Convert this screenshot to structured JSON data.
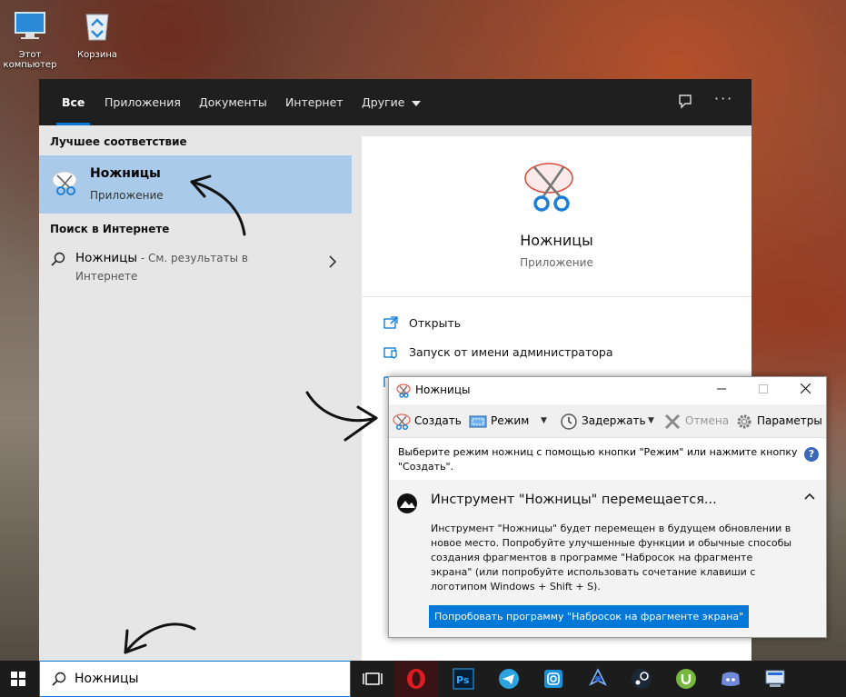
{
  "desktop": {
    "icons": [
      {
        "label": "Этот компьютер",
        "icon": "this-pc-icon"
      },
      {
        "label": "Корзина",
        "icon": "recycle-bin-icon"
      }
    ]
  },
  "start_menu": {
    "tabs": [
      {
        "label": "Все",
        "active": true
      },
      {
        "label": "Приложения"
      },
      {
        "label": "Документы"
      },
      {
        "label": "Интернет"
      },
      {
        "label": "Другие"
      }
    ],
    "feedback_icon": "feedback-icon",
    "more_icon": "more-options-icon",
    "best_match_header": "Лучшее соответствие",
    "best_match": {
      "name": "Ножницы",
      "type": "Приложение",
      "icon": "snipping-tool-icon"
    },
    "web_header": "Поиск в Интернете",
    "web_result": {
      "query": "Ножницы",
      "suffix": " - См. результаты в Интернете"
    },
    "detail": {
      "name": "Ножницы",
      "type": "Приложение",
      "actions": [
        {
          "label": "Открыть",
          "icon": "open-icon"
        },
        {
          "label": "Запуск от имени администратора",
          "icon": "run-as-admin-icon"
        },
        {
          "label": "",
          "icon": "file-location-icon"
        }
      ]
    }
  },
  "snipping_window": {
    "title": "Ножницы",
    "toolbar": {
      "new": "Создать",
      "mode": "Режим",
      "delay": "Задержать",
      "cancel": "Отмена",
      "options": "Параметры"
    },
    "hint": "Выберите режим ножниц с помощью кнопки \"Режим\" или нажмите кнопку \"Создать\".",
    "notice_title": "Инструмент \"Ножницы\" перемещается...",
    "notice_body": "Инструмент \"Ножницы\" будет перемещен в будущем обновлении в новое место. Попробуйте улучшенные функции и обычные способы создания фрагментов в программе \"Набросок на фрагменте экрана\" (или попробуйте использовать сочетание клавиши с логотипом Windows + Shift + S).",
    "cta": "Попробовать программу \"Набросок на фрагменте экрана\""
  },
  "taskbar": {
    "search_value": "Ножницы",
    "apps": [
      "task-view-icon",
      "opera-icon",
      "photoshop-icon",
      "telegram-icon",
      "instagram-icon",
      "app-icon",
      "steam-icon",
      "utorrent-icon",
      "discord-icon",
      "network-app-icon"
    ]
  },
  "colors": {
    "accent": "#0078d7",
    "selection": "#a9cbe9",
    "taskbar": "#1c1c1c"
  }
}
